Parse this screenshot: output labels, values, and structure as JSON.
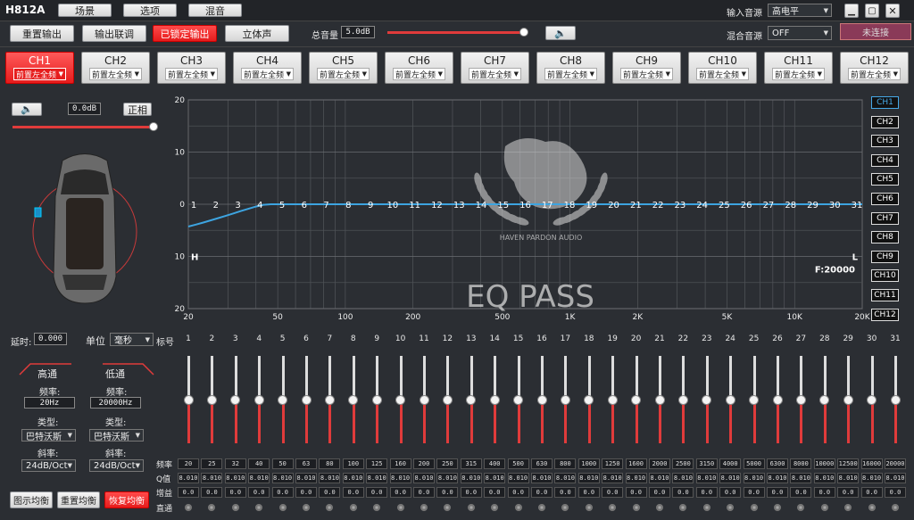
{
  "app": {
    "title": "H812A"
  },
  "menu": [
    {
      "label": "场景"
    },
    {
      "label": "选项"
    },
    {
      "label": "混音"
    }
  ],
  "input_source": {
    "label": "输入音源",
    "value": "高电平"
  },
  "mix_source": {
    "label": "混合音源",
    "value": "OFF"
  },
  "connect_label": "未连接",
  "toolbar": {
    "reset_output": "重置输出",
    "output_link": "输出联调",
    "locked_output": "已锁定输出",
    "stereo": "立体声",
    "master_volume_label": "总音量",
    "master_volume_value": "5.0dB",
    "master_volume_level": 0.98
  },
  "channels": [
    {
      "name": "CH1",
      "sel": "前置左全频"
    },
    {
      "name": "CH2",
      "sel": "前置左全频"
    },
    {
      "name": "CH3",
      "sel": "前置左全频"
    },
    {
      "name": "CH4",
      "sel": "前置左全频"
    },
    {
      "name": "CH5",
      "sel": "前置左全频"
    },
    {
      "name": "CH6",
      "sel": "前置左全频"
    },
    {
      "name": "CH7",
      "sel": "前置左全频"
    },
    {
      "name": "CH8",
      "sel": "前置左全频"
    },
    {
      "name": "CH9",
      "sel": "前置左全频"
    },
    {
      "name": "CH10",
      "sel": "前置左全频"
    },
    {
      "name": "CH11",
      "sel": "前置左全频"
    },
    {
      "name": "CH12",
      "sel": "前置左全频"
    }
  ],
  "side_channels": [
    "CH1",
    "CH2",
    "CH3",
    "CH4",
    "CH5",
    "CH6",
    "CH7",
    "CH8",
    "CH9",
    "CH10",
    "CH11",
    "CH12"
  ],
  "left_panel": {
    "gain_value": "0.0dB",
    "phase_label": "正相",
    "gain_level": 1.0,
    "delay_label": "延时:",
    "delay_value": "0.000",
    "unit_label": "单位",
    "unit_value": "毫秒",
    "index_label": "标号"
  },
  "highpass": {
    "title": "高通",
    "freq_label": "频率:",
    "freq_value": "20Hz",
    "type_label": "类型:",
    "type_value": "巴特沃斯",
    "slope_label": "斜率:",
    "slope_value": "24dB/Oct"
  },
  "lowpass": {
    "title": "低通",
    "freq_label": "频率:",
    "freq_value": "20000Hz",
    "type_label": "类型:",
    "type_value": "巴特沃斯",
    "slope_label": "斜率:",
    "slope_value": "24dB/Oct"
  },
  "bottom_buttons": {
    "graphic_eq": "图示均衡",
    "reset_eq": "重置均衡",
    "restore_eq": "恢复均衡"
  },
  "eq_graph": {
    "y_ticks": [
      "+20",
      "+10",
      "0",
      "-10",
      "-20"
    ],
    "x_ticks": [
      "20",
      "50",
      "100",
      "200",
      "500",
      "1K",
      "2K",
      "5K",
      "10K",
      "20K"
    ],
    "band_numbers": [
      "1",
      "2",
      "3",
      "4",
      "5",
      "6",
      "7",
      "8",
      "9",
      "10",
      "11",
      "12",
      "13",
      "14",
      "15",
      "16",
      "17",
      "18",
      "19",
      "20",
      "21",
      "22",
      "23",
      "24",
      "25",
      "26",
      "27",
      "28",
      "29",
      "30",
      "31"
    ],
    "h_marker": "H",
    "l_marker": "L",
    "freq_readout": "F:20000",
    "watermark_brand": "HAVEN PARDON AUDIO",
    "watermark_text": "EQ PASS"
  },
  "eq_table": {
    "row_labels": {
      "freq": "频率",
      "q": "Q值",
      "gain": "增益",
      "bypass": "直通"
    },
    "freqs": [
      "20",
      "25",
      "32",
      "40",
      "50",
      "63",
      "80",
      "100",
      "125",
      "160",
      "200",
      "250",
      "315",
      "400",
      "500",
      "630",
      "800",
      "1000",
      "1250",
      "1600",
      "2000",
      "2500",
      "3150",
      "4000",
      "5000",
      "6300",
      "8000",
      "10000",
      "12500",
      "16000",
      "20000"
    ],
    "q_value": "8.010",
    "gain_value": "0.0",
    "slider_level": 0.5
  },
  "colors": {
    "accent_red": "#e61c1c",
    "curve_blue": "#3da4e0"
  }
}
